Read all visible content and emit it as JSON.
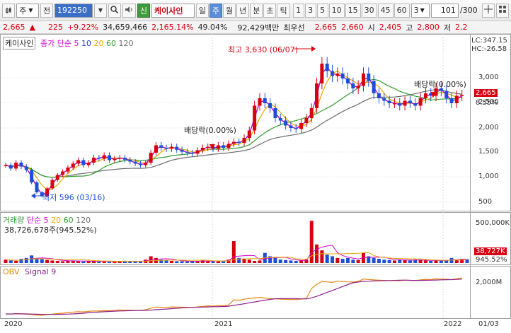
{
  "toolbar": {
    "chart_type_icon": "candlestick-icon",
    "period_select": "주",
    "prev_label": "전",
    "stock_code": "192250",
    "stock_name": "케이사인",
    "new_badge": "신",
    "period_tabs": [
      "일",
      "주",
      "월",
      "년",
      "분",
      "초",
      "틱"
    ],
    "active_tab": "주",
    "intervals": [
      "1",
      "3",
      "5",
      "10",
      "15",
      "30",
      "45",
      "60"
    ],
    "interval_select": "3",
    "count": "101",
    "total": "/300"
  },
  "quote": {
    "price": "2,665",
    "change_arrow": "▲",
    "change": "225",
    "change_pct": "+9.22%",
    "volume": "34,659,466",
    "volume_pct": "2,165.14%",
    "turnover_rate": "49.04%",
    "amount": "92,429백만",
    "priority": "최우선",
    "ask": "2,665",
    "bid": "2,660",
    "open_label": "시",
    "open": "2,405",
    "high_label": "고",
    "high": "2,800",
    "low_label": "저",
    "low": "2,2"
  },
  "price_panel": {
    "name_box": "케이사인",
    "legend_label": "종가 단순",
    "ma_periods": [
      "5",
      "10",
      "20",
      "60",
      "120"
    ],
    "lc": "LC:347.15",
    "hc": "HC:-26.58",
    "y_ticks": [
      "3,000",
      "2,500",
      "2,000",
      "1,500",
      "1,000",
      "500"
    ],
    "price_tag": "2,665",
    "pct_tag": "8.55%",
    "high_annotation": "최고 3,630 (06/07)",
    "low_annotation": "최저 596 (03/16)",
    "dividend_1": "배당락(0.00%)",
    "dividend_2": "배당락(0.00%)"
  },
  "volume_panel": {
    "legend_label": "거래량",
    "legend_ma": "단순",
    "ma_periods": [
      "5",
      "20",
      "60",
      "120"
    ],
    "current": "38,726,678주(945.52%)",
    "y_ticks": [
      "500,000K"
    ],
    "tag_value": "38,727K",
    "tag_pct": "945.52%"
  },
  "obv_panel": {
    "legend_obv": "OBV",
    "legend_signal": "Signal 9",
    "y_ticks": [
      "2,000M"
    ]
  },
  "x_axis": {
    "labels": [
      "2020",
      "2021",
      "2022"
    ],
    "right_label": "01/03"
  },
  "colors": {
    "up": "#d7000f",
    "down": "#1e4ed8",
    "ma5": "#d000d0",
    "ma10": "#1e3fc9",
    "ma20": "#e8a800",
    "ma60": "#2f9a2f",
    "ma120": "#6b6b6b"
  },
  "chart_data": {
    "type": "candlestick",
    "closes": [
      1250,
      1180,
      1300,
      1220,
      1150,
      900,
      700,
      620,
      780,
      950,
      1050,
      1120,
      1200,
      1280,
      1350,
      1250,
      1300,
      1400,
      1380,
      1450,
      1350,
      1380,
      1400,
      1360,
      1320,
      1280,
      1250,
      1300,
      1500,
      1650,
      1600,
      1580,
      1620,
      1560,
      1520,
      1500,
      1480,
      1550,
      1600,
      1620,
      1580,
      1650,
      1600,
      1680,
      1720,
      1700,
      1800,
      1950,
      2450,
      2600,
      2500,
      2400,
      2200,
      2150,
      2050,
      2000,
      1980,
      2100,
      2200,
      2400,
      2900,
      3300,
      3150,
      3050,
      3100,
      3000,
      2900,
      2800,
      2850,
      3100,
      2950,
      2700,
      2600,
      2550,
      2500,
      2500,
      2450,
      2550,
      2500,
      2450,
      2600,
      2700,
      2650,
      2800,
      2750,
      2600,
      2500,
      2650,
      2665
    ],
    "volumes": [
      40,
      30,
      25,
      50,
      60,
      90,
      55,
      45,
      35,
      30,
      25,
      20,
      30,
      25,
      20,
      18,
      22,
      25,
      20,
      18,
      15,
      18,
      20,
      25,
      22,
      18,
      20,
      40,
      80,
      60,
      40,
      30,
      25,
      22,
      20,
      18,
      20,
      25,
      30,
      25,
      20,
      22,
      25,
      40,
      260,
      60,
      50,
      40,
      25,
      30,
      120,
      80,
      60,
      40,
      35,
      30,
      25,
      30,
      40,
      500,
      220,
      150,
      100,
      80,
      60,
      50,
      60,
      40,
      35,
      120,
      80,
      60,
      50,
      40,
      35,
      30,
      40,
      35,
      30,
      40,
      35,
      30,
      25,
      30,
      35,
      30,
      60,
      40,
      50,
      45
    ],
    "ylim": [
      400,
      3700
    ]
  }
}
